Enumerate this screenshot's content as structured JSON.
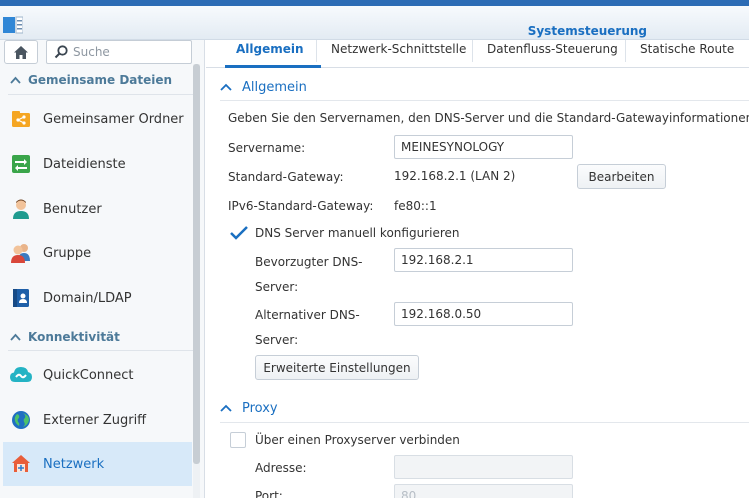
{
  "app": {
    "title": "Systemsteuerung"
  },
  "search": {
    "placeholder": "Suche"
  },
  "sidebar": {
    "sections": [
      {
        "label": "Gemeinsame Dateien",
        "items": [
          {
            "label": "Gemeinsamer Ordner",
            "icon": "shared-folder-icon"
          },
          {
            "label": "Dateidienste",
            "icon": "file-services-icon"
          },
          {
            "label": "Benutzer",
            "icon": "user-icon"
          },
          {
            "label": "Gruppe",
            "icon": "group-icon"
          },
          {
            "label": "Domain/LDAP",
            "icon": "domain-icon"
          }
        ]
      },
      {
        "label": "Konnektivität",
        "items": [
          {
            "label": "QuickConnect",
            "icon": "quickconnect-icon"
          },
          {
            "label": "Externer Zugriff",
            "icon": "globe-icon"
          },
          {
            "label": "Netzwerk",
            "icon": "network-house-icon",
            "active": true
          }
        ]
      }
    ]
  },
  "tabs": [
    {
      "label": "Allgemein",
      "active": true
    },
    {
      "label": "Netzwerk-Schnittstelle"
    },
    {
      "label": "Datenfluss-Steuerung"
    },
    {
      "label": "Statische Route"
    }
  ],
  "general": {
    "heading": "Allgemein",
    "description": "Geben Sie den Servernamen, den DNS-Server und die Standard-Gatewayinformationen ein",
    "server_name_label": "Servername:",
    "server_name_value": "MEINESYNOLOGY",
    "gateway_label": "Standard-Gateway:",
    "gateway_value": "192.168.2.1 (LAN 2)",
    "edit_button": "Bearbeiten",
    "ipv6_gateway_label": "IPv6-Standard-Gateway:",
    "ipv6_gateway_value": "fe80::1",
    "dns_manual_label": "DNS Server manuell konfigurieren",
    "dns_manual_checked": true,
    "preferred_dns_label_1": "Bevorzugter DNS-",
    "preferred_dns_label_2": "Server:",
    "preferred_dns_value": "192.168.2.1",
    "alternative_dns_label_1": "Alternativer DNS-",
    "alternative_dns_label_2": "Server:",
    "alternative_dns_value": "192.168.0.50",
    "advanced_button": "Erweiterte Einstellungen"
  },
  "proxy": {
    "heading": "Proxy",
    "use_proxy_label": "Über einen Proxyserver verbinden",
    "use_proxy_checked": false,
    "address_label": "Adresse:",
    "address_value": "",
    "port_label": "Port:",
    "port_value": "80"
  },
  "colors": {
    "accent": "#1a6fc1",
    "active_bg": "#d7e9f9",
    "section_text": "#4d7a99"
  }
}
